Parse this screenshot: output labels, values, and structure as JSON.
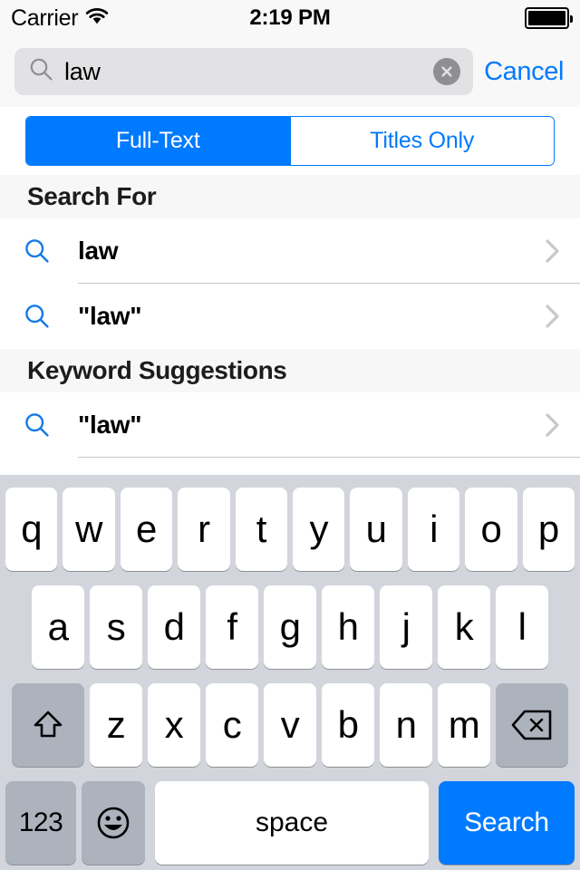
{
  "status_bar": {
    "carrier": "Carrier",
    "wifi_icon": "wifi-icon",
    "time": "2:19 PM",
    "battery_icon": "battery-full-icon"
  },
  "search": {
    "icon": "search-icon",
    "value": "law",
    "placeholder": "Search",
    "clear_icon": "clear-circle-icon",
    "cancel_label": "Cancel"
  },
  "scope_bar": {
    "options": [
      {
        "label": "Full-Text",
        "selected": true
      },
      {
        "label": "Titles Only",
        "selected": false
      }
    ]
  },
  "sections": [
    {
      "header": "Search For",
      "rows": [
        {
          "icon": "search-icon",
          "label": "law",
          "accessory": "chevron-right-icon"
        },
        {
          "icon": "search-icon",
          "label": "\"law\"",
          "accessory": "chevron-right-icon"
        }
      ]
    },
    {
      "header": "Keyword Suggestions",
      "rows": [
        {
          "icon": "search-icon",
          "label": "\"law\"",
          "accessory": "chevron-right-icon"
        }
      ]
    }
  ],
  "keyboard": {
    "row1": [
      "q",
      "w",
      "e",
      "r",
      "t",
      "y",
      "u",
      "i",
      "o",
      "p"
    ],
    "row2": [
      "a",
      "s",
      "d",
      "f",
      "g",
      "h",
      "j",
      "k",
      "l"
    ],
    "row3_letters": [
      "z",
      "x",
      "c",
      "v",
      "b",
      "n",
      "m"
    ],
    "shift_icon": "shift-arrow-icon",
    "delete_icon": "backspace-icon",
    "numbers_label": "123",
    "emoji_icon": "emoji-smiley-icon",
    "space_label": "space",
    "return_label": "Search"
  },
  "colors": {
    "accent_blue": "#007aff",
    "status_bg": "#f8f8f8",
    "search_field_bg": "#e2e2e5",
    "section_header_bg": "#f7f7f7",
    "keyboard_bg": "#d2d5db",
    "key_white": "#ffffff",
    "key_gray": "#adb3bd",
    "separator": "#c8c7cc",
    "chevron_gray": "#c7c7cc"
  }
}
